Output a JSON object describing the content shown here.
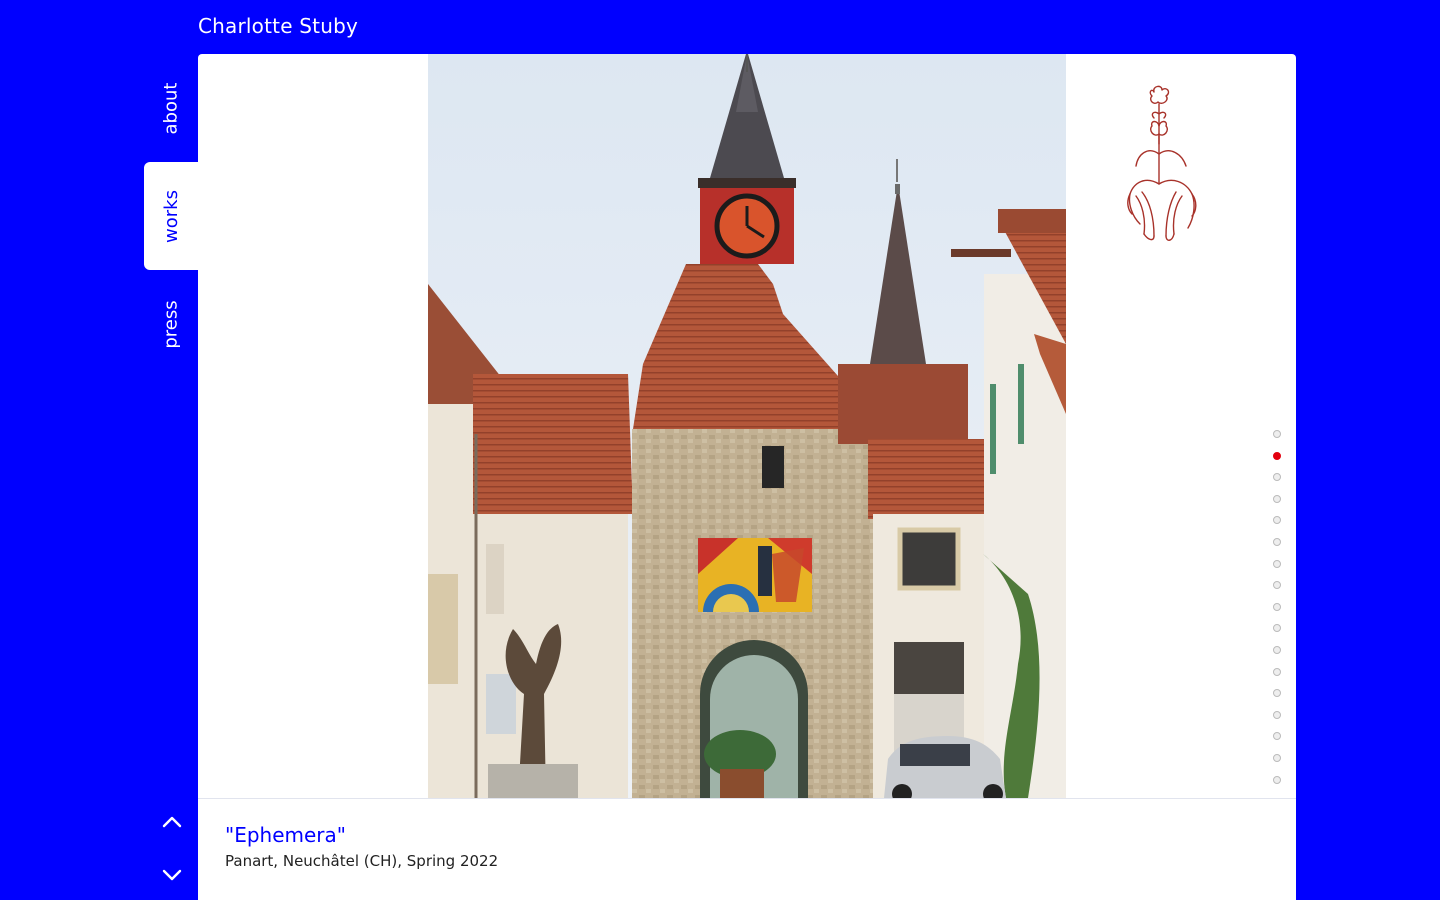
{
  "site": {
    "title": "Charlotte Stuby"
  },
  "nav": {
    "items": [
      {
        "label": "about",
        "active": false
      },
      {
        "label": "works",
        "active": true
      },
      {
        "label": "press",
        "active": false
      }
    ]
  },
  "controls": {
    "up_icon": "chevron-up-icon",
    "down_icon": "chevron-down-icon"
  },
  "slider": {
    "total": 17,
    "current": 2,
    "active_color": "#e3000f"
  },
  "work": {
    "title": "\"Ephemera\"",
    "details": "Panart, Neuchâtel (CH), Spring 2022"
  },
  "colors": {
    "brand": "#0000ff",
    "accent": "#e3000f",
    "logo_stroke": "#a8322a"
  }
}
